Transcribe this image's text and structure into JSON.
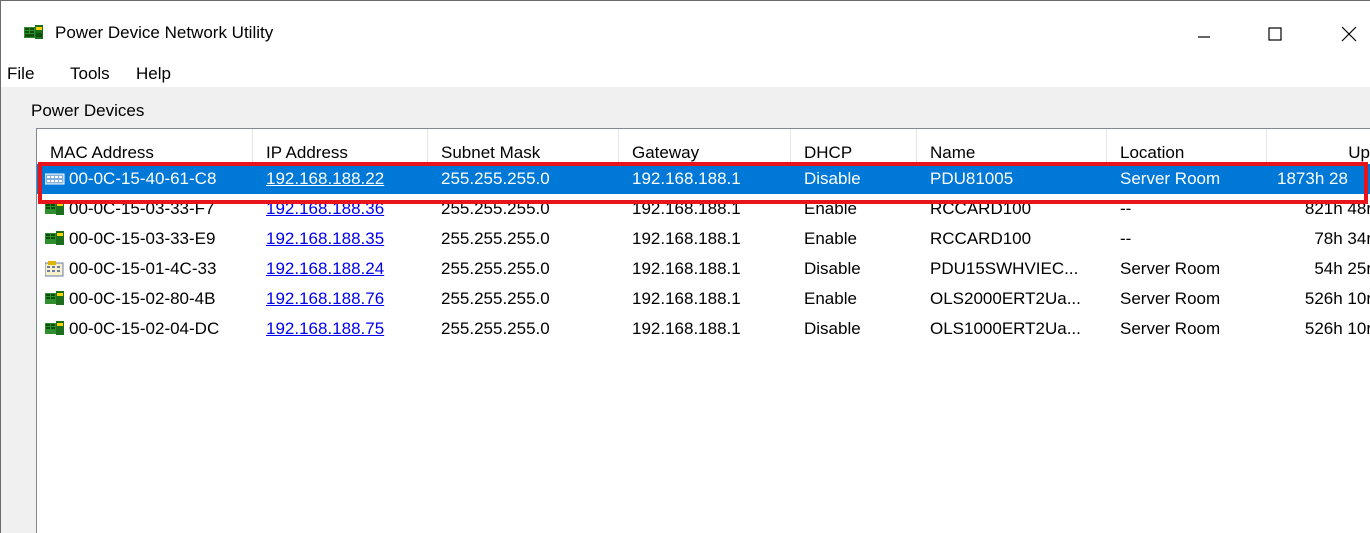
{
  "window": {
    "title": "Power Device Network Utility",
    "icon": "network-card-icon",
    "controls": {
      "minimize": "minimize-icon",
      "maximize": "maximize-icon",
      "close": "close-icon"
    }
  },
  "menu": {
    "items": [
      "File",
      "Tools",
      "Help"
    ]
  },
  "group": {
    "label": "Power Devices"
  },
  "columns": [
    "MAC Address",
    "IP Address",
    "Subnet Mask",
    "Gateway",
    "DHCP",
    "Name",
    "Location",
    "Up"
  ],
  "rows": [
    {
      "icon": "pdu-blue-icon",
      "mac": "00-0C-15-40-61-C8",
      "ip": "192.168.188.22",
      "subnet": "255.255.255.0",
      "gateway": "192.168.188.1",
      "dhcp": "Disable",
      "name": "PDU81005",
      "location": "Server Room",
      "up": "1873h 28",
      "selected": true
    },
    {
      "icon": "network-card-icon",
      "mac": "00-0C-15-03-33-F7",
      "ip": "192.168.188.36",
      "subnet": "255.255.255.0",
      "gateway": "192.168.188.1",
      "dhcp": "Enable",
      "name": "RCCARD100",
      "location": "--",
      "up": "821h 48r",
      "selected": false
    },
    {
      "icon": "network-card-icon",
      "mac": "00-0C-15-03-33-E9",
      "ip": "192.168.188.35",
      "subnet": "255.255.255.0",
      "gateway": "192.168.188.1",
      "dhcp": "Enable",
      "name": "RCCARD100",
      "location": "--",
      "up": "78h 34r",
      "selected": false
    },
    {
      "icon": "pdu-switched-icon",
      "mac": "00-0C-15-01-4C-33",
      "ip": "192.168.188.24",
      "subnet": "255.255.255.0",
      "gateway": "192.168.188.1",
      "dhcp": "Disable",
      "name": "PDU15SWHVIEC...",
      "location": "Server Room",
      "up": "54h 25r",
      "selected": false
    },
    {
      "icon": "network-card-icon",
      "mac": "00-0C-15-02-80-4B",
      "ip": "192.168.188.76",
      "subnet": "255.255.255.0",
      "gateway": "192.168.188.1",
      "dhcp": "Enable",
      "name": "OLS2000ERT2Ua...",
      "location": "Server Room",
      "up": "526h 10r",
      "selected": false
    },
    {
      "icon": "network-card-icon",
      "mac": "00-0C-15-02-04-DC",
      "ip": "192.168.188.75",
      "subnet": "255.255.255.0",
      "gateway": "192.168.188.1",
      "dhcp": "Disable",
      "name": "OLS1000ERT2Ua...",
      "location": "Server Room",
      "up": "526h 10r",
      "selected": false
    }
  ],
  "colors": {
    "selection": "#0078d7",
    "highlight": "#e8141c",
    "link": "#0000ee"
  }
}
